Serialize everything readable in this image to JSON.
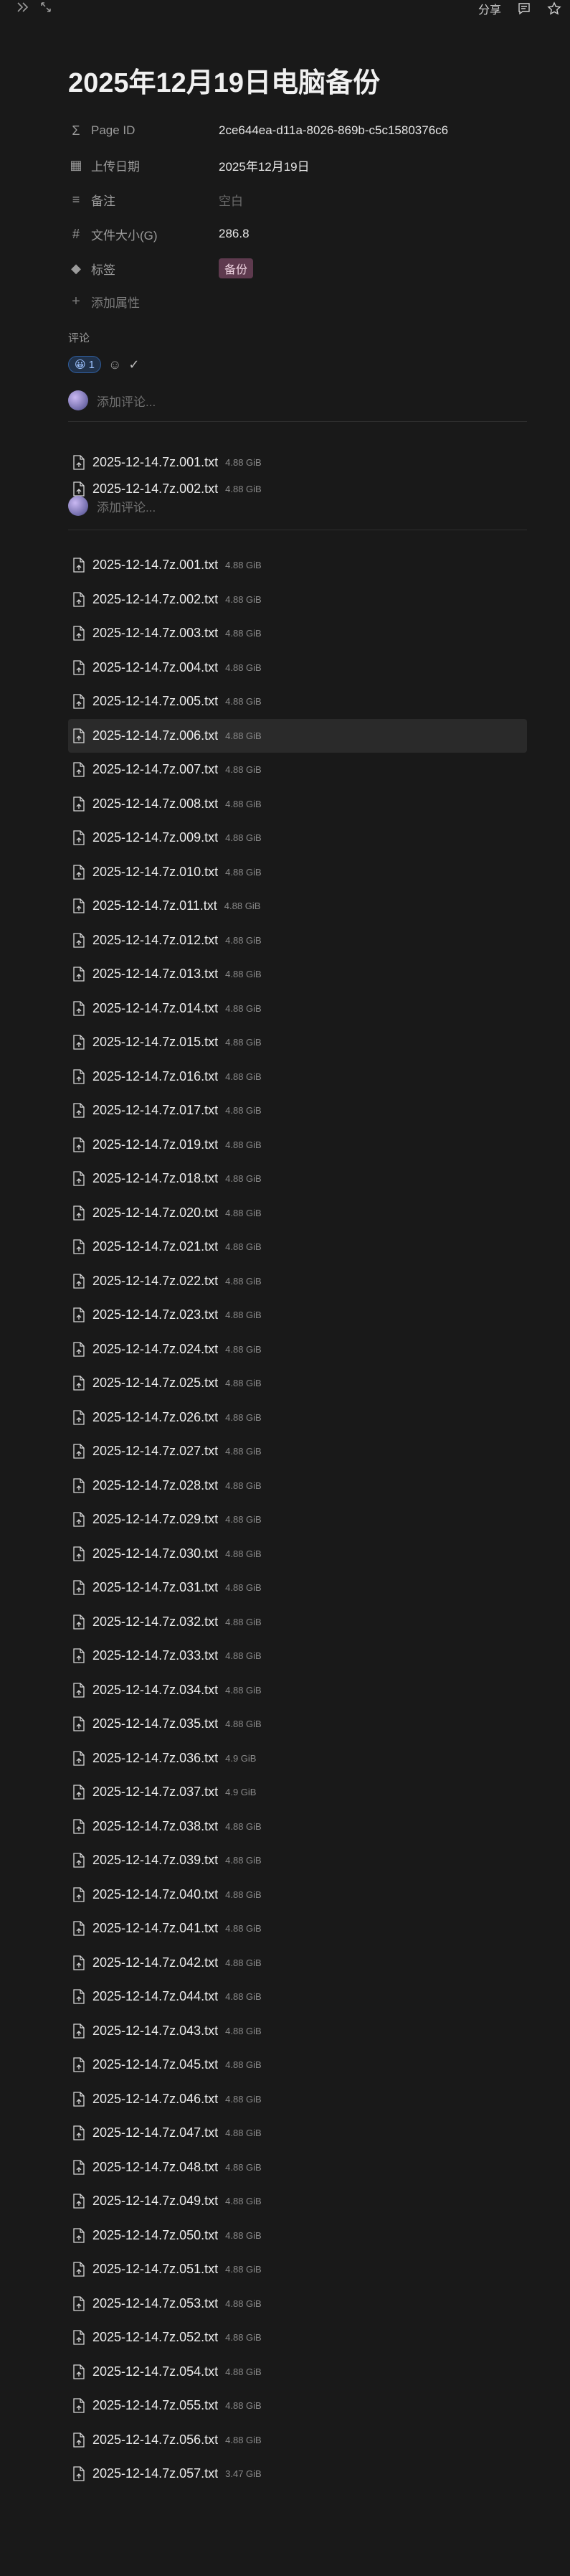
{
  "topbar": {
    "share_label": "分享"
  },
  "page": {
    "title": "2025年12月19日电脑备份"
  },
  "properties": [
    {
      "icon": "sigma-icon",
      "glyph": "Σ",
      "key": "Page ID",
      "value": "2ce644ea-d11a-8026-869b-c5c1580376c6",
      "style": "text"
    },
    {
      "icon": "calendar-icon",
      "glyph": "▦",
      "key": "上传日期",
      "value": "2025年12月19日",
      "style": "text"
    },
    {
      "icon": "lines-icon",
      "glyph": "≡",
      "key": "备注",
      "value": "空白",
      "style": "empty"
    },
    {
      "icon": "hash-icon",
      "glyph": "#",
      "key": "文件大小(G)",
      "value": "286.8",
      "style": "text"
    },
    {
      "icon": "tag-icon",
      "glyph": "◆",
      "key": "标签",
      "value": "备份",
      "style": "tag"
    }
  ],
  "add_property_label": "添加属性",
  "comments": {
    "label": "评论",
    "reaction_emoji": "😀",
    "reaction_count": "1",
    "placeholder": "添加评论..."
  },
  "overlap_files": [
    {
      "name": "2025-12-14.7z.001.txt",
      "size": "4.88 GiB"
    },
    {
      "name": "2025-12-14.7z.002.txt",
      "size": "4.88 GiB"
    }
  ],
  "files": [
    {
      "name": "2025-12-14.7z.001.txt",
      "size": "4.88 GiB"
    },
    {
      "name": "2025-12-14.7z.002.txt",
      "size": "4.88 GiB"
    },
    {
      "name": "2025-12-14.7z.003.txt",
      "size": "4.88 GiB"
    },
    {
      "name": "2025-12-14.7z.004.txt",
      "size": "4.88 GiB"
    },
    {
      "name": "2025-12-14.7z.005.txt",
      "size": "4.88 GiB"
    },
    {
      "name": "2025-12-14.7z.006.txt",
      "size": "4.88 GiB"
    },
    {
      "name": "2025-12-14.7z.007.txt",
      "size": "4.88 GiB"
    },
    {
      "name": "2025-12-14.7z.008.txt",
      "size": "4.88 GiB"
    },
    {
      "name": "2025-12-14.7z.009.txt",
      "size": "4.88 GiB"
    },
    {
      "name": "2025-12-14.7z.010.txt",
      "size": "4.88 GiB"
    },
    {
      "name": "2025-12-14.7z.011.txt",
      "size": "4.88 GiB"
    },
    {
      "name": "2025-12-14.7z.012.txt",
      "size": "4.88 GiB"
    },
    {
      "name": "2025-12-14.7z.013.txt",
      "size": "4.88 GiB"
    },
    {
      "name": "2025-12-14.7z.014.txt",
      "size": "4.88 GiB"
    },
    {
      "name": "2025-12-14.7z.015.txt",
      "size": "4.88 GiB"
    },
    {
      "name": "2025-12-14.7z.016.txt",
      "size": "4.88 GiB"
    },
    {
      "name": "2025-12-14.7z.017.txt",
      "size": "4.88 GiB"
    },
    {
      "name": "2025-12-14.7z.019.txt",
      "size": "4.88 GiB"
    },
    {
      "name": "2025-12-14.7z.018.txt",
      "size": "4.88 GiB"
    },
    {
      "name": "2025-12-14.7z.020.txt",
      "size": "4.88 GiB"
    },
    {
      "name": "2025-12-14.7z.021.txt",
      "size": "4.88 GiB"
    },
    {
      "name": "2025-12-14.7z.022.txt",
      "size": "4.88 GiB"
    },
    {
      "name": "2025-12-14.7z.023.txt",
      "size": "4.88 GiB"
    },
    {
      "name": "2025-12-14.7z.024.txt",
      "size": "4.88 GiB"
    },
    {
      "name": "2025-12-14.7z.025.txt",
      "size": "4.88 GiB"
    },
    {
      "name": "2025-12-14.7z.026.txt",
      "size": "4.88 GiB"
    },
    {
      "name": "2025-12-14.7z.027.txt",
      "size": "4.88 GiB"
    },
    {
      "name": "2025-12-14.7z.028.txt",
      "size": "4.88 GiB"
    },
    {
      "name": "2025-12-14.7z.029.txt",
      "size": "4.88 GiB"
    },
    {
      "name": "2025-12-14.7z.030.txt",
      "size": "4.88 GiB"
    },
    {
      "name": "2025-12-14.7z.031.txt",
      "size": "4.88 GiB"
    },
    {
      "name": "2025-12-14.7z.032.txt",
      "size": "4.88 GiB"
    },
    {
      "name": "2025-12-14.7z.033.txt",
      "size": "4.88 GiB"
    },
    {
      "name": "2025-12-14.7z.034.txt",
      "size": "4.88 GiB"
    },
    {
      "name": "2025-12-14.7z.035.txt",
      "size": "4.88 GiB"
    },
    {
      "name": "2025-12-14.7z.036.txt",
      "size": "4.9 GiB"
    },
    {
      "name": "2025-12-14.7z.037.txt",
      "size": "4.9 GiB"
    },
    {
      "name": "2025-12-14.7z.038.txt",
      "size": "4.88 GiB"
    },
    {
      "name": "2025-12-14.7z.039.txt",
      "size": "4.88 GiB"
    },
    {
      "name": "2025-12-14.7z.040.txt",
      "size": "4.88 GiB"
    },
    {
      "name": "2025-12-14.7z.041.txt",
      "size": "4.88 GiB"
    },
    {
      "name": "2025-12-14.7z.042.txt",
      "size": "4.88 GiB"
    },
    {
      "name": "2025-12-14.7z.044.txt",
      "size": "4.88 GiB"
    },
    {
      "name": "2025-12-14.7z.043.txt",
      "size": "4.88 GiB"
    },
    {
      "name": "2025-12-14.7z.045.txt",
      "size": "4.88 GiB"
    },
    {
      "name": "2025-12-14.7z.046.txt",
      "size": "4.88 GiB"
    },
    {
      "name": "2025-12-14.7z.047.txt",
      "size": "4.88 GiB"
    },
    {
      "name": "2025-12-14.7z.048.txt",
      "size": "4.88 GiB"
    },
    {
      "name": "2025-12-14.7z.049.txt",
      "size": "4.88 GiB"
    },
    {
      "name": "2025-12-14.7z.050.txt",
      "size": "4.88 GiB"
    },
    {
      "name": "2025-12-14.7z.051.txt",
      "size": "4.88 GiB"
    },
    {
      "name": "2025-12-14.7z.053.txt",
      "size": "4.88 GiB"
    },
    {
      "name": "2025-12-14.7z.052.txt",
      "size": "4.88 GiB"
    },
    {
      "name": "2025-12-14.7z.054.txt",
      "size": "4.88 GiB"
    },
    {
      "name": "2025-12-14.7z.055.txt",
      "size": "4.88 GiB"
    },
    {
      "name": "2025-12-14.7z.056.txt",
      "size": "4.88 GiB"
    },
    {
      "name": "2025-12-14.7z.057.txt",
      "size": "3.47 GiB"
    }
  ],
  "highlighted_file": "2025-12-14.7z.006.txt",
  "colors": {
    "background": "#191919",
    "tag_bg": "#5e3a4e",
    "reaction_border": "#2f5d9c"
  }
}
